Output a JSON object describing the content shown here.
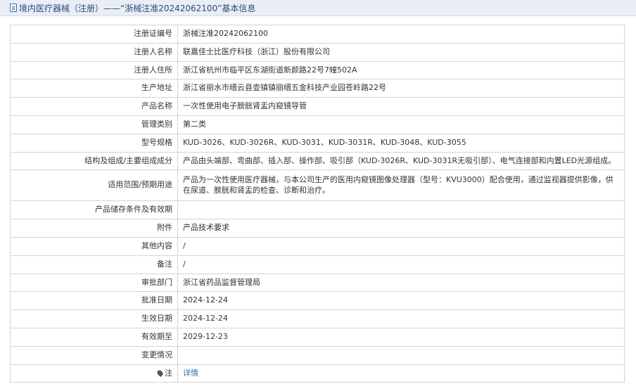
{
  "header": {
    "title": "境内医疗器械（注册）——“浙械注准20242062100”基本信息"
  },
  "rows": [
    {
      "label": "注册证编号",
      "value": "浙械注准20242062100"
    },
    {
      "label": "注册人名称",
      "value": "联嘉佳士比医疗科技（浙江）股份有限公司"
    },
    {
      "label": "注册人住所",
      "value": "浙江省杭州市临平区东湖街道新颜路22号7幢502A"
    },
    {
      "label": "生产地址",
      "value": "浙江省丽水市缙云县壶镇镇丽缙五金科技产业园苍岭路22号"
    },
    {
      "label": "产品名称",
      "value": "一次性使用电子膀胱肾盂内窥镜导管"
    },
    {
      "label": "管理类别",
      "value": "第二类"
    },
    {
      "label": "型号规格",
      "value": "KUD-3026、KUD-3026R、KUD-3031、KUD-3031R、KUD-3048、KUD-3055"
    },
    {
      "label": "结构及组成/主要组成成分",
      "value": "产品由头端部、弯曲部、插入部、操作部、吸引部（KUD-3026R、KUD-3031R无吸引部）、电气连接部和内置LED光源组成。"
    },
    {
      "label": "适用范围/预期用途",
      "value": "产品为一次性使用医疗器械，与本公司生产的医用内窥镜图像处理器（型号：KVU3000）配合使用，通过监视器提供影像，供在尿道、膀胱和肾盂的检查、诊断和治疗。"
    },
    {
      "label": "产品储存条件及有效期",
      "value": ""
    },
    {
      "label": "附件",
      "value": "产品技术要求"
    },
    {
      "label": "其他内容",
      "value": "/"
    },
    {
      "label": "备注",
      "value": "/"
    },
    {
      "label": "审批部门",
      "value": "浙江省药品监督管理局"
    },
    {
      "label": "批准日期",
      "value": "2024-12-24"
    },
    {
      "label": "生效日期",
      "value": "2024-12-24"
    },
    {
      "label": "有效期至",
      "value": "2029-12-23"
    },
    {
      "label": "变更情况",
      "value": ""
    }
  ],
  "note": {
    "label": "注",
    "link_text": "详情"
  }
}
